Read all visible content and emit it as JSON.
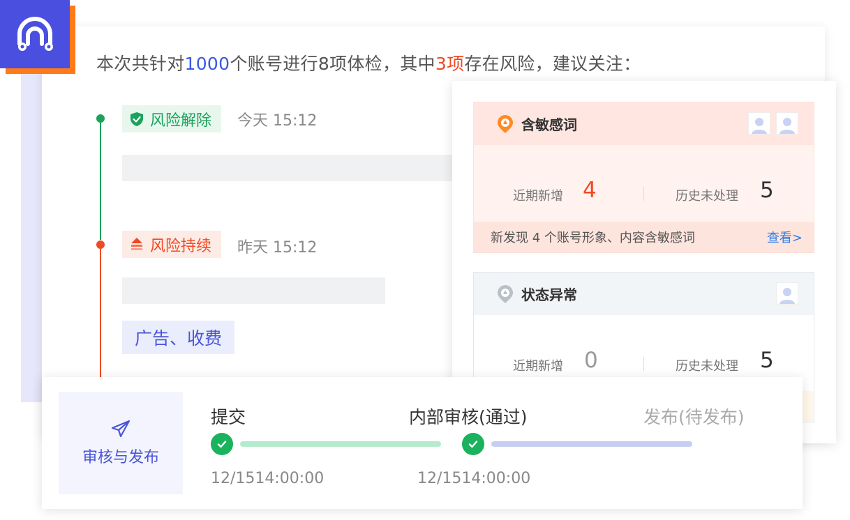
{
  "summary": {
    "part1": "本次共针对",
    "accounts": "1000",
    "part2": "个账号进行8项体检，其中",
    "risk_count": "3项",
    "part3": "存在风险，建议关注："
  },
  "timeline": [
    {
      "tag": "风险解除",
      "time": "今天 15:12",
      "status": "resolved",
      "icon": "shield-check-icon"
    },
    {
      "tag": "风险持续",
      "time": "昨天 15:12",
      "status": "ongoing",
      "icon": "arrow-up-layers-icon",
      "chip": "广告、收费"
    }
  ],
  "risk_cards": [
    {
      "title": "含敏感词",
      "icon": "warning-pin-icon",
      "recent_label": "近期新增",
      "recent_value": "4",
      "history_label": "历史未处理",
      "history_value": "5",
      "footer_text": "新发现 4 个账号形象、内容含敏感词",
      "footer_link": "查看>"
    },
    {
      "title": "状态异常",
      "icon": "warning-pin-icon",
      "recent_label": "近期新增",
      "recent_value": "0",
      "history_label": "历史未处理",
      "history_value": "5"
    }
  ],
  "workflow": {
    "title": "审核与发布",
    "steps": [
      {
        "label": "提交",
        "date": "12/1514:00:00",
        "done": true
      },
      {
        "label": "内部审核(通过)",
        "date": "12/1514:00:00",
        "done": true
      },
      {
        "label": "发布(待发布)",
        "done": false
      }
    ]
  },
  "colors": {
    "brand_blue": "#4a4fe0",
    "brand_orange": "#ff7a1a",
    "risk_red": "#f04a24",
    "success_green": "#1bb25e",
    "link_blue": "#2f7fe6"
  }
}
